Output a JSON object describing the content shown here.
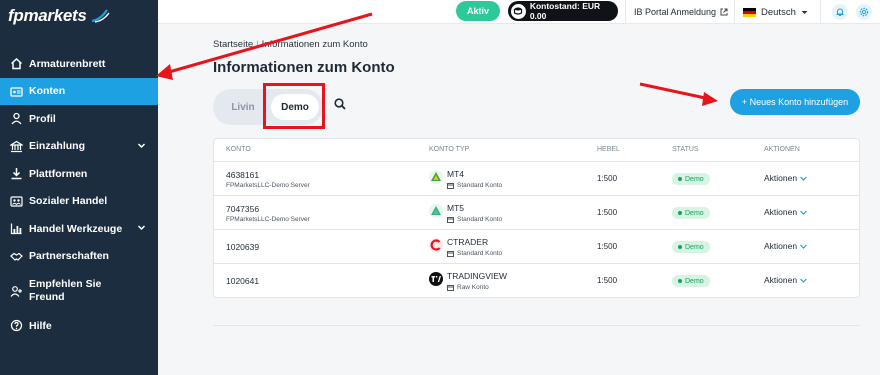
{
  "brand": {
    "logo_text": "fpmarkets"
  },
  "sidebar": {
    "items": [
      {
        "label": "Armaturenbrett",
        "icon": "home-icon"
      },
      {
        "label": "Konten",
        "icon": "id-card-icon",
        "active": true
      },
      {
        "label": "Profil",
        "icon": "user-icon"
      },
      {
        "label": "Einzahlung",
        "icon": "bank-icon",
        "expandable": true
      },
      {
        "label": "Plattformen",
        "icon": "download-icon"
      },
      {
        "label": "Sozialer Handel",
        "icon": "people-icon"
      },
      {
        "label": "Handel Werkzeuge",
        "icon": "chart-icon",
        "expandable": true
      },
      {
        "label": "Partnerschaften",
        "icon": "handshake-icon"
      },
      {
        "label": "Empfehlen Sie Freund",
        "icon": "user-plus-icon"
      },
      {
        "label": "Hilfe",
        "icon": "help-icon"
      }
    ]
  },
  "topbar": {
    "status_button": "Aktiv",
    "balance_label": "Kontostand: EUR 0.00",
    "ib_portal_link": "IB Portal Anmeldung",
    "language": "Deutsch"
  },
  "breadcrumb": {
    "home": "Startseite",
    "current": "Informationen zum Konto"
  },
  "page": {
    "title": "Informationen zum Konto"
  },
  "tabs": {
    "live": "Livin",
    "demo": "Demo",
    "selected": "Demo"
  },
  "add_account_button": "+ Neues Konto hinzufügen",
  "table": {
    "columns": [
      "KONTO",
      "KONTO TYP",
      "HEBEL",
      "STATUS",
      "AKTIONEN"
    ],
    "rows": [
      {
        "account": "4638161",
        "server": "FPMarketsLLC-Demo Server",
        "platform": "MT4",
        "account_type": "Standard Konto",
        "leverage": "1:500",
        "status": "Demo",
        "action": "Aktionen"
      },
      {
        "account": "7047356",
        "server": "FPMarketsLLC-Demo Server",
        "platform": "MT5",
        "account_type": "Standard Konto",
        "leverage": "1:500",
        "status": "Demo",
        "action": "Aktionen"
      },
      {
        "account": "1020639",
        "server": "",
        "platform": "CTRADER",
        "account_type": "Standard Konto",
        "leverage": "1:500",
        "status": "Demo",
        "action": "Aktionen"
      },
      {
        "account": "1020641",
        "server": "",
        "platform": "TRADINGVIEW",
        "account_type": "Raw Konto",
        "leverage": "1:500",
        "status": "Demo",
        "action": "Aktionen"
      }
    ]
  },
  "colors": {
    "sidebar_bg": "#1b2d3e",
    "accent": "#1da1e2",
    "annotation": "#e8141b",
    "aktiv": "#2ec99b"
  }
}
